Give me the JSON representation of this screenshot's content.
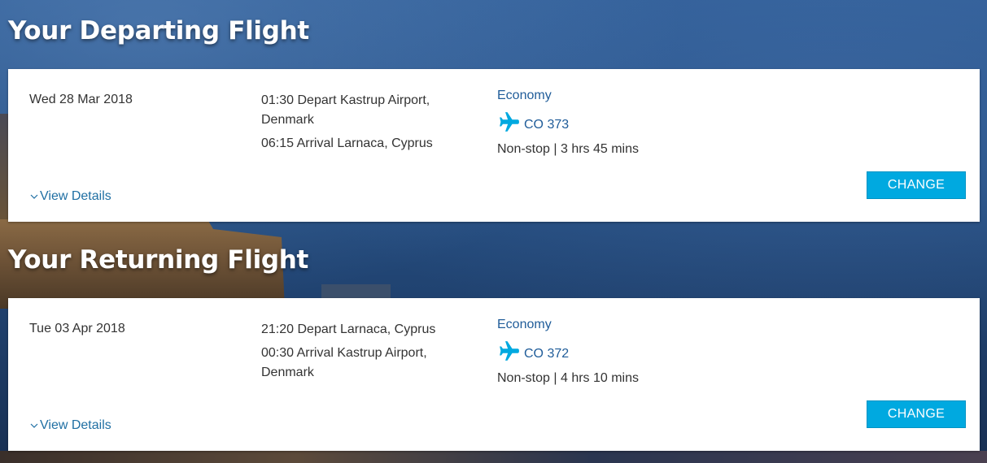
{
  "theme": {
    "accent": "#00a9e0",
    "link": "#1f6fa3",
    "cabin_text": "#1f5c99"
  },
  "departing": {
    "title": "Your Departing Flight",
    "date": "Wed 28 Mar 2018",
    "depart_line_1": "01:30 Depart Kastrup Airport,",
    "depart_line_2": "Denmark",
    "arrival": "06:15 Arrival Larnaca, Cyprus",
    "cabin": "Economy",
    "flight_no": "CO 373",
    "duration": "Non-stop | 3 hrs 45 mins",
    "view_details": "View Details",
    "change_label": "CHANGE",
    "icon": "plane-icon"
  },
  "returning": {
    "title": "Your Returning Flight",
    "date": "Tue 03 Apr 2018",
    "depart": "21:20 Depart Larnaca, Cyprus",
    "arrival_line_1": "00:30 Arrival Kastrup Airport,",
    "arrival_line_2": "Denmark",
    "cabin": "Economy",
    "flight_no": "CO 372",
    "duration": "Non-stop | 4 hrs 10 mins",
    "view_details": "View Details",
    "change_label": "CHANGE",
    "icon": "plane-icon"
  }
}
